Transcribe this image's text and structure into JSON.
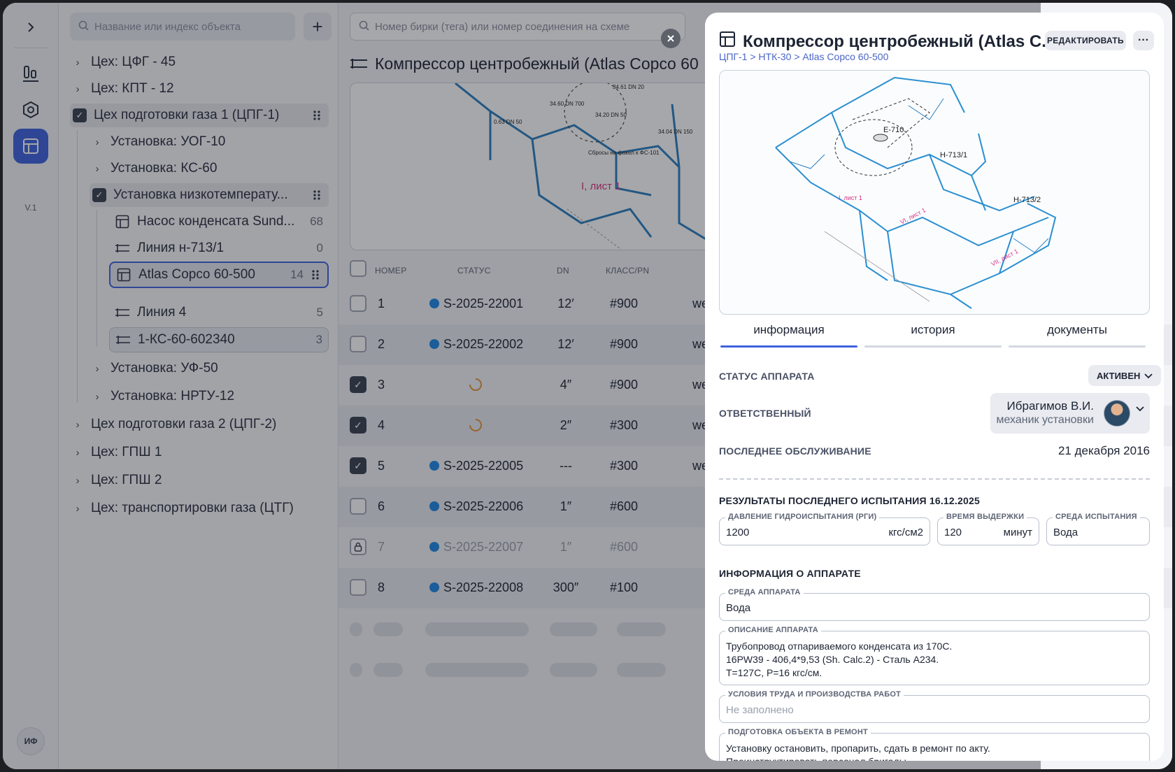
{
  "rail": {
    "version": "V.1",
    "avatar": "ИФ"
  },
  "tree": {
    "search_placeholder": "Название или индекс объекта",
    "add_label": "+",
    "nodes": [
      {
        "label": "Цех: ЦФГ - 45"
      },
      {
        "label": "Цех: КПТ - 12"
      },
      {
        "label": "Цех подготовки газа 1 (ЦПГ-1)"
      },
      {
        "label": "Установка: УОГ-10"
      },
      {
        "label": "Установка: КС-60"
      },
      {
        "label": "Установка низкотемперату..."
      },
      {
        "label": "Насос конденсата Sund...",
        "count": "68"
      },
      {
        "label": "Линия н-713/1",
        "count": "0"
      },
      {
        "label": "Atlas Copco 60-500",
        "count": "14"
      },
      {
        "label": "Линия 4",
        "count": "5"
      },
      {
        "label": "1-КС-60-602340",
        "count": "3"
      },
      {
        "label": "Установка: УФ-50"
      },
      {
        "label": "Установка: НРТУ-12"
      },
      {
        "label": "Цех подготовки газа 2 (ЦПГ-2)"
      },
      {
        "label": "Цех: ГПШ 1"
      },
      {
        "label": "Цех: ГПШ 2"
      },
      {
        "label": "Цех: транспортировки газа (ЦТГ)"
      }
    ]
  },
  "main": {
    "search_placeholder": "Номер бирки (тега) или номер соединения на схеме",
    "title": "Компрессор центробежный (Atlas Copco 60",
    "scheme_labels": [
      "34.60 DN 700",
      "34.20 DN 50",
      "0.63 DN 50",
      "34.61 DN 20",
      "34.04 DN 150",
      "Сбросы на факел к ФС-101",
      "I, лист 1"
    ],
    "columns": {
      "num": "НОМЕР",
      "status": "СТАТУС",
      "dn": "DN",
      "cls": "КЛАСС/PN"
    },
    "rows": [
      {
        "num": "1",
        "status": "S-2025-22001",
        "dn": "12′",
        "cls": "#900",
        "extra": "we",
        "checked": false
      },
      {
        "num": "2",
        "status": "S-2025-22002",
        "dn": "12′",
        "cls": "#900",
        "extra": "we",
        "checked": false
      },
      {
        "num": "3",
        "status": "",
        "dn": "4″",
        "cls": "#900",
        "extra": "we",
        "checked": true
      },
      {
        "num": "4",
        "status": "",
        "dn": "2″",
        "cls": "#300",
        "extra": "we",
        "checked": true
      },
      {
        "num": "5",
        "status": "S-2025-22005",
        "dn": "---",
        "cls": "#300",
        "extra": "we",
        "checked": true
      },
      {
        "num": "6",
        "status": "S-2025-22006",
        "dn": "1″",
        "cls": "#600",
        "extra": "",
        "checked": false
      },
      {
        "num": "7",
        "status": "S-2025-22007",
        "dn": "1″",
        "cls": "#600",
        "extra": "",
        "checked": false
      },
      {
        "num": "8",
        "status": "S-2025-22008",
        "dn": "300″",
        "cls": "#100",
        "extra": "",
        "checked": false
      }
    ]
  },
  "drawer": {
    "title": "Компрессор центробежный (Atlas C...",
    "breadcrumb": "ЦПГ-1 > НТК-30 > Atlas Copco 60-500",
    "edit_label": "РЕДАКТИРОВАТЬ",
    "more_label": "···",
    "scheme_labels": [
      "E-710",
      "H-713/1",
      "H-713/2",
      "I, лист 1",
      "VI, лист 1",
      "VII, лист 1"
    ],
    "tabs": [
      "информация",
      "история",
      "документы"
    ],
    "status_label": "СТАТУС АППАРАТА",
    "status_value": "АКТИВЕН",
    "responsible_label": "ОТВЕТСТВЕННЫЙ",
    "responsible_name": "Ибрагимов В.И.",
    "responsible_role": "механик установки",
    "service_label": "ПОСЛЕДНЕЕ ОБСЛУЖИВАНИЕ",
    "service_date": "21 декабря 2016",
    "test_title": "РЕЗУЛЬТАТЫ ПОСЛЕДНЕГО ИСПЫТАНИЯ 16.12.2025",
    "test": {
      "pressure_label": "ДАВЛЕНИЕ ГИДРОИСПЫТАНИЯ (РГИ)",
      "pressure_value": "1200",
      "pressure_unit": "кгс/см2",
      "time_label": "ВРЕМЯ ВЫДЕРЖКИ",
      "time_value": "120",
      "time_unit": "минут",
      "medium_label": "СРЕДА ИСПЫТАНИЯ",
      "medium_value": "Вода"
    },
    "info_title": "ИНФОРМАЦИЯ О АППАРАТЕ",
    "info": {
      "medium_label": "СРЕДА АППАРАТА",
      "medium_value": "Вода",
      "desc_label": "ОПИСАНИЕ АППАРАТА",
      "desc_value": "Трубопровод отпариваемого конденсата из 170С.\n16PW39 - 406,4*9,53 (Sh. Calc.2) - Сталь A234.\nT=127C, P=16 кгс/см.",
      "conditions_label": "УСЛОВИЯ ТРУДА И ПРОИЗВОДСТВА РАБОТ",
      "conditions_placeholder": "Не заполнено",
      "prep_label": "ПОДГОТОВКА ОБЪЕКТА В РЕМОНТ",
      "prep_value": "Установку остановить, пропарить, сдать в ремонт по акту.\nПроинструктировать персонал бригады."
    }
  }
}
